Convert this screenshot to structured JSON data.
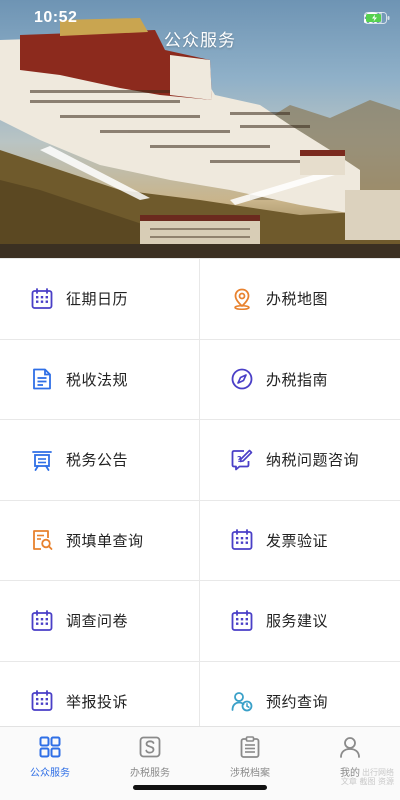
{
  "status_bar": {
    "time": "10:52"
  },
  "header": {
    "title": "公众服务"
  },
  "services": [
    {
      "label": "征期日历",
      "icon": "calendar-icon"
    },
    {
      "label": "办税地图",
      "icon": "map-pin-icon"
    },
    {
      "label": "税收法规",
      "icon": "document-icon"
    },
    {
      "label": "办税指南",
      "icon": "compass-icon"
    },
    {
      "label": "税务公告",
      "icon": "announcement-board-icon"
    },
    {
      "label": "纳税问题咨询",
      "icon": "consult-edit-icon"
    },
    {
      "label": "预填单查询",
      "icon": "form-search-icon"
    },
    {
      "label": "发票验证",
      "icon": "calendar-icon"
    },
    {
      "label": "调查问卷",
      "icon": "calendar-icon"
    },
    {
      "label": "服务建议",
      "icon": "calendar-icon"
    },
    {
      "label": "举报投诉",
      "icon": "calendar-icon"
    },
    {
      "label": "预约查询",
      "icon": "appointment-people-icon"
    }
  ],
  "tabbar": {
    "items": [
      {
        "label": "公众服务",
        "icon": "grid-icon",
        "active": true
      },
      {
        "label": "办税服务",
        "icon": "tax-s-icon",
        "active": false
      },
      {
        "label": "涉税档案",
        "icon": "clipboard-icon",
        "active": false
      },
      {
        "label": "我的",
        "icon": "user-icon",
        "active": false
      }
    ]
  },
  "watermark": {
    "line1": "出行网络",
    "line2": "文章 截图 资源"
  },
  "colors": {
    "accent_blue": "#2f6fe6",
    "icon_purple": "#4a3fc7",
    "icon_orange": "#e8822e",
    "icon_teal": "#3aa0c8",
    "text_dark": "#222222",
    "tab_inactive": "#8a8a8a"
  }
}
